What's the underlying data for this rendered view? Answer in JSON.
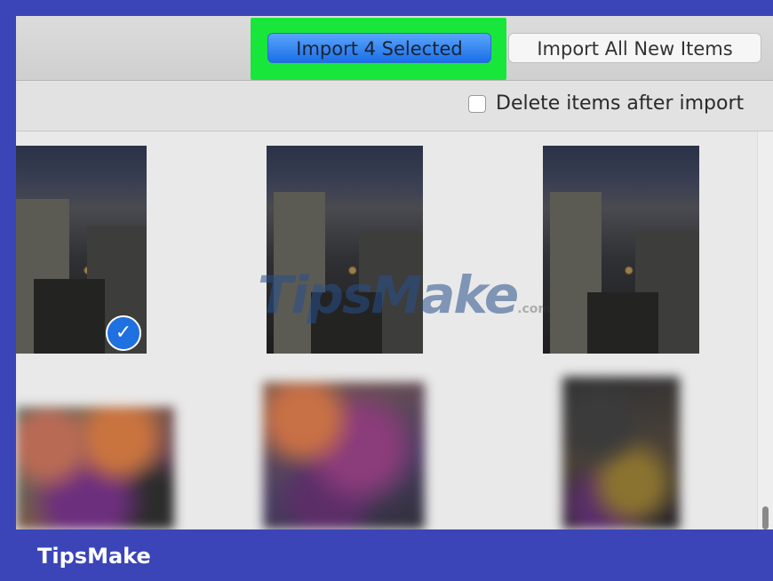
{
  "toolbar": {
    "import_selected_label": "Import 4 Selected",
    "import_all_label": "Import All New Items"
  },
  "options": {
    "delete_after_import_label": "Delete items after import",
    "delete_after_import_checked": false
  },
  "photos": [
    {
      "id": "photo-1",
      "kind": "night-cityscape",
      "selected": true
    },
    {
      "id": "photo-2",
      "kind": "night-cityscape",
      "selected": false
    },
    {
      "id": "photo-3",
      "kind": "night-cityscape",
      "selected": false
    },
    {
      "id": "photo-4",
      "kind": "blurred",
      "selected": false
    },
    {
      "id": "photo-5",
      "kind": "blurred",
      "selected": false
    },
    {
      "id": "photo-6",
      "kind": "blurred",
      "selected": false
    }
  ],
  "selected_icon": "checkmark-icon",
  "watermark": {
    "main": "TipsMake",
    "suffix": ".com"
  },
  "footer": {
    "brand": "TipsMake"
  },
  "colors": {
    "highlight": "#19e63a",
    "primary_button": "#1a6fe8",
    "frame": "#3b45b8"
  }
}
